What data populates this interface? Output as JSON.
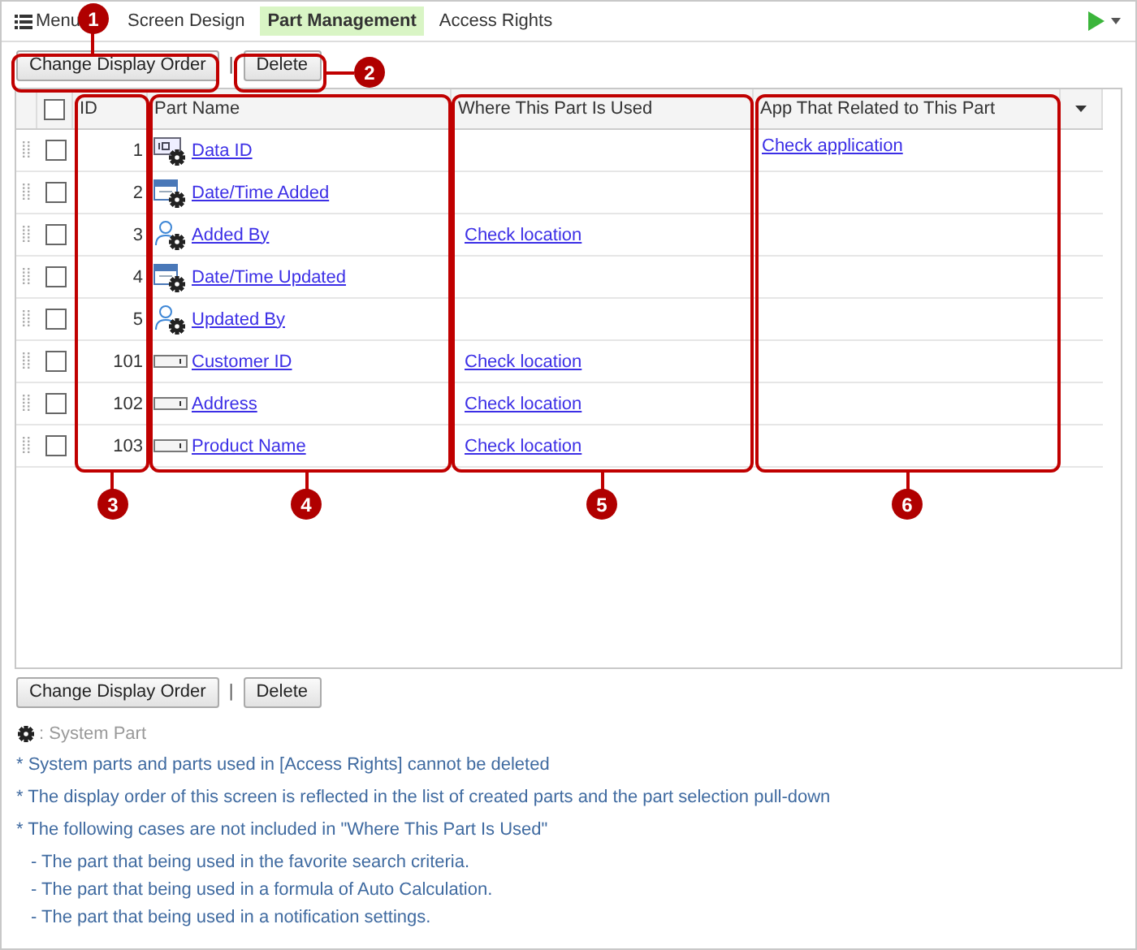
{
  "nav": {
    "menu": "Menu",
    "tabs": [
      {
        "label": "Screen Design",
        "selected": false
      },
      {
        "label": "Part Management",
        "selected": true
      },
      {
        "label": "Access Rights",
        "selected": false
      }
    ]
  },
  "toolbar_top": {
    "buttons": [
      "Change Display Order",
      "Delete"
    ],
    "separator": "|"
  },
  "table": {
    "all_checked": false,
    "columns": [
      "ID",
      "Part Name",
      "Where This Part Is Used",
      "App That Related to This Part"
    ],
    "rows": [
      {
        "id": "1",
        "name": "Data ID",
        "kind": "data-id",
        "system": true,
        "checked": false,
        "where": "",
        "app": "Check application"
      },
      {
        "id": "2",
        "name": "Date/Time Added",
        "kind": "datetime",
        "system": true,
        "checked": false,
        "where": "",
        "app": ""
      },
      {
        "id": "3",
        "name": "Added By",
        "kind": "user",
        "system": true,
        "checked": false,
        "where": "Check location",
        "app": ""
      },
      {
        "id": "4",
        "name": "Date/Time Updated",
        "kind": "datetime",
        "system": true,
        "checked": false,
        "where": "",
        "app": ""
      },
      {
        "id": "5",
        "name": "Updated By",
        "kind": "user",
        "system": true,
        "checked": false,
        "where": "",
        "app": ""
      },
      {
        "id": "101",
        "name": "Customer ID",
        "kind": "text",
        "system": false,
        "checked": false,
        "where": "Check location",
        "app": ""
      },
      {
        "id": "102",
        "name": "Address",
        "kind": "text",
        "system": false,
        "checked": false,
        "where": "Check location",
        "app": ""
      },
      {
        "id": "103",
        "name": "Product Name",
        "kind": "text",
        "system": false,
        "checked": false,
        "where": "Check location",
        "app": ""
      }
    ]
  },
  "toolbar_bottom": {
    "buttons": [
      "Change Display Order",
      "Delete"
    ],
    "separator": "|"
  },
  "legend": ": System Part",
  "notes": [
    {
      "kind": "note",
      "text": "* System parts and parts used in [Access Rights] cannot be deleted"
    },
    {
      "kind": "note",
      "text": "* The display order of this screen is reflected in the list of created parts and the part selection pull-down"
    },
    {
      "kind": "note",
      "text": "* The following cases are not included in \"Where This Part Is Used\""
    },
    {
      "kind": "sub",
      "text": "- The part that being used in the favorite search criteria."
    },
    {
      "kind": "sub",
      "text": "- The part that being used in a formula of Auto Calculation."
    },
    {
      "kind": "sub",
      "text": "- The part that being used in a notification settings."
    }
  ],
  "callouts": [
    "1",
    "2",
    "3",
    "4",
    "5",
    "6"
  ]
}
